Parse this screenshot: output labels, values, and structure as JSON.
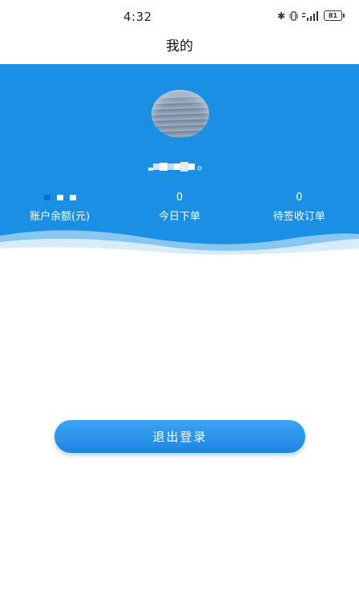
{
  "status_bar": {
    "time": "4:32",
    "battery": "81",
    "icons": [
      "bluetooth-icon",
      "vibrate-icon",
      "signal-icon",
      "battery-icon"
    ]
  },
  "header": {
    "title": "我的"
  },
  "profile": {
    "username_suffix": "。",
    "stats": [
      {
        "value": "",
        "label": "账户余额(元)"
      },
      {
        "value": "0",
        "label": "今日下单"
      },
      {
        "value": "0",
        "label": "待签收订单"
      }
    ]
  },
  "logout": {
    "label": "退出登录"
  },
  "colors": {
    "primary_blue": "#1a8fe3",
    "button_blue": "#2b95ea",
    "wave_light": "#a8d6f7"
  }
}
